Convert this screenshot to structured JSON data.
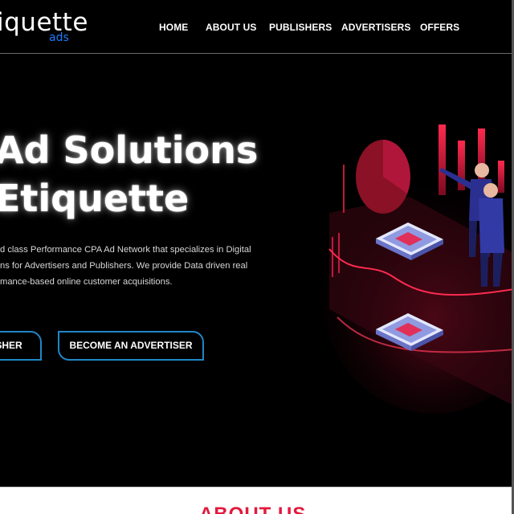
{
  "brand": {
    "logo_main": "iquette",
    "logo_sub": "ads"
  },
  "nav": {
    "items": [
      {
        "label": "HOME"
      },
      {
        "label": "ABOUT US"
      },
      {
        "label": "PUBLISHERS"
      },
      {
        "label": "ADVERTISERS"
      },
      {
        "label": "OFFERS"
      }
    ]
  },
  "hero": {
    "title_line1": "Ad Solutions",
    "title_line2": "Etiquette",
    "description_lines": [
      "d class Performance CPA Ad Network that specializes in Digital",
      "ns for Advertisers and Publishers. We provide Data driven real",
      "mance-based online customer acquisitions."
    ],
    "buttons": {
      "publisher": "SHER",
      "advertiser": "BECOME AN ADVERTISER"
    }
  },
  "section": {
    "about_heading": "ABOUT US"
  },
  "colors": {
    "background": "#000000",
    "accent_blue": "#1f87c7",
    "logo_blue": "#1e7bff",
    "accent_red": "#e21a3d"
  },
  "icons": {
    "illustration": "analytics-illustration"
  }
}
